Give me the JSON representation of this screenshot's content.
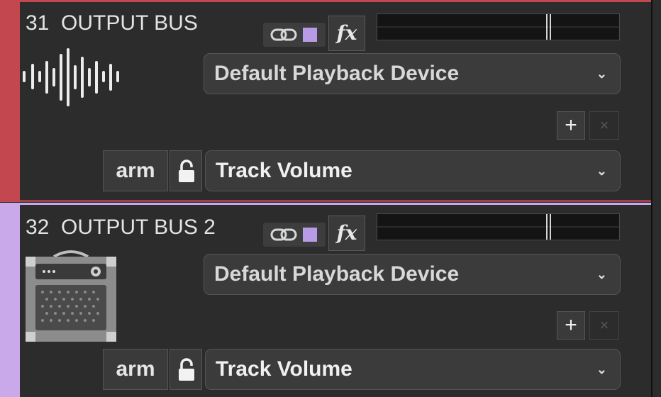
{
  "colors": {
    "track1": "#c2474f",
    "track2": "#c9a9ea",
    "panel": "#2c2c2c",
    "swatch": "#b79be6"
  },
  "tracks": [
    {
      "number": "31",
      "name": "OUTPUT BUS",
      "icon": "waveform-icon",
      "fx_label": "fx",
      "device": "Default Playback Device",
      "add_label": "+",
      "remove_label": "×",
      "arm_label": "arm",
      "param": "Track Volume",
      "chevron": "⌄"
    },
    {
      "number": "32",
      "name": "OUTPUT BUS 2",
      "icon": "guitar-amp-icon",
      "fx_label": "fx",
      "device": "Default Playback Device",
      "add_label": "+",
      "remove_label": "×",
      "arm_label": "arm",
      "param": "Track Volume",
      "chevron": "⌄"
    }
  ]
}
